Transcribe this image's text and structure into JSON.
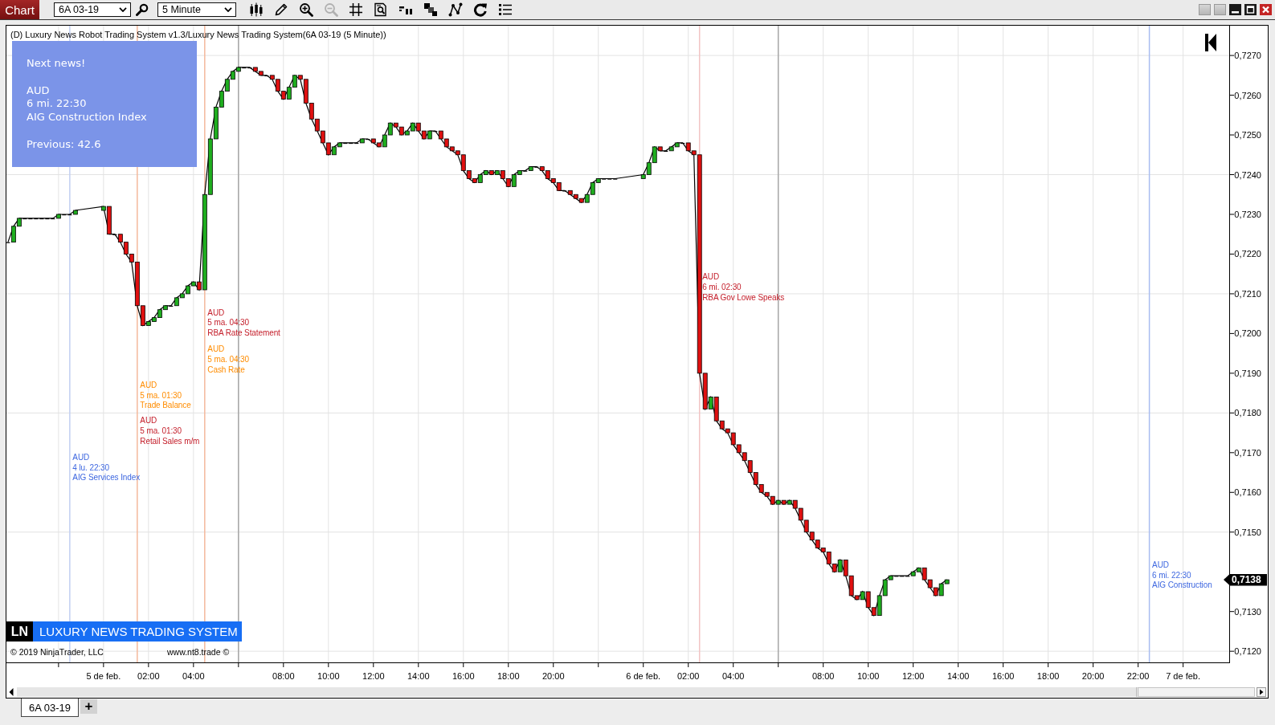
{
  "toolbar": {
    "title": "Chart",
    "instrument": "6A 03-19",
    "interval": "5 Minute",
    "zoom_out": {
      "disabled": true
    }
  },
  "chart": {
    "title": "(D) Luxury News Robot Trading System v1.3/Luxury News Trading System(6A 03-19 (5 Minute))",
    "next_news": {
      "heading": "Next news!",
      "currency": "AUD",
      "time": "6 mi. 22:30",
      "event": "AIG Construction Index",
      "previous": "Previous: 42.6"
    },
    "last_price": "0,7138",
    "news_labels": [
      {
        "color": "#3f68e0"
      },
      {
        "color": "#ff8c00"
      },
      {
        "color": "#c41e2a"
      },
      {
        "color": "#c41e2a"
      },
      {
        "color": "#ff8c00"
      },
      {
        "color": "#c41e2a"
      },
      {
        "color": "#3f68e0"
      }
    ],
    "branding": {
      "badge": "LN",
      "name": "LUXURY NEWS TRADING SYSTEM"
    },
    "copyright": "© 2019 NinjaTrader, LLC",
    "website": "www.nt8.trade ©",
    "chart_data": {
      "type": "line",
      "xlim": [
        "2019-02-04T19:41",
        "2019-02-07T02:03"
      ],
      "ylim": [
        0.71172,
        0.72775
      ],
      "xticks": [
        {
          "value": "2019-02-05T00:00",
          "label": "5 de feb."
        },
        {
          "value": "2019-02-05T02:00",
          "label": "02:00"
        },
        {
          "value": "2019-02-05T04:00",
          "label": "04:00"
        },
        {
          "value": "2019-02-05T08:00",
          "label": "08:00"
        },
        {
          "value": "2019-02-05T10:00",
          "label": "10:00"
        },
        {
          "value": "2019-02-05T12:00",
          "label": "12:00"
        },
        {
          "value": "2019-02-05T14:00",
          "label": "14:00"
        },
        {
          "value": "2019-02-05T16:00",
          "label": "16:00"
        },
        {
          "value": "2019-02-05T18:00",
          "label": "18:00"
        },
        {
          "value": "2019-02-05T20:00",
          "label": "20:00"
        },
        {
          "value": "2019-02-06T00:00",
          "label": "6 de feb."
        },
        {
          "value": "2019-02-06T02:00",
          "label": "02:00"
        },
        {
          "value": "2019-02-06T04:00",
          "label": "04:00"
        },
        {
          "value": "2019-02-06T08:00",
          "label": "08:00"
        },
        {
          "value": "2019-02-06T10:00",
          "label": "10:00"
        },
        {
          "value": "2019-02-06T12:00",
          "label": "12:00"
        },
        {
          "value": "2019-02-06T14:00",
          "label": "14:00"
        },
        {
          "value": "2019-02-06T16:00",
          "label": "16:00"
        },
        {
          "value": "2019-02-06T18:00",
          "label": "18:00"
        },
        {
          "value": "2019-02-06T20:00",
          "label": "20:00"
        },
        {
          "value": "2019-02-06T22:00",
          "label": "22:00"
        },
        {
          "value": "2019-02-07T00:00",
          "label": "7 de feb."
        }
      ],
      "yticks": [
        {
          "value": 0.727,
          "label": "0,7270"
        },
        {
          "value": 0.726,
          "label": "0,7260"
        },
        {
          "value": 0.725,
          "label": "0,7250"
        },
        {
          "value": 0.724,
          "label": "0,7240"
        },
        {
          "value": 0.723,
          "label": "0,7230"
        },
        {
          "value": 0.722,
          "label": "0,7220"
        },
        {
          "value": 0.721,
          "label": "0,7210"
        },
        {
          "value": 0.72,
          "label": "0,7200"
        },
        {
          "value": 0.719,
          "label": "0,7190"
        },
        {
          "value": 0.718,
          "label": "0,7180"
        },
        {
          "value": 0.717,
          "label": "0,7170"
        },
        {
          "value": 0.716,
          "label": "0,7160"
        },
        {
          "value": 0.715,
          "label": "0,7150"
        },
        {
          "value": 0.713,
          "label": "0,7130"
        },
        {
          "value": 0.712,
          "label": "0,7120"
        }
      ],
      "x": [
        "2019-02-04T19:45",
        "2019-02-04T20:00",
        "2019-02-04T20:15",
        "2019-02-04T20:30",
        "2019-02-04T20:45",
        "2019-02-04T21:00",
        "2019-02-04T21:15",
        "2019-02-04T21:30",
        "2019-02-04T21:45",
        "2019-02-04T22:00",
        "2019-02-04T22:15",
        "2019-02-04T22:30",
        "2019-02-04T22:45",
        "2019-02-05T00:00",
        "2019-02-05T00:15",
        "2019-02-05T00:30",
        "2019-02-05T00:45",
        "2019-02-05T01:00",
        "2019-02-05T01:15",
        "2019-02-05T01:30",
        "2019-02-05T01:45",
        "2019-02-05T02:00",
        "2019-02-05T02:15",
        "2019-02-05T02:30",
        "2019-02-05T02:45",
        "2019-02-05T03:00",
        "2019-02-05T03:15",
        "2019-02-05T03:30",
        "2019-02-05T03:45",
        "2019-02-05T04:00",
        "2019-02-05T04:15",
        "2019-02-05T04:30",
        "2019-02-05T04:45",
        "2019-02-05T05:00",
        "2019-02-05T05:15",
        "2019-02-05T05:30",
        "2019-02-05T05:45",
        "2019-02-05T06:00",
        "2019-02-05T06:15",
        "2019-02-05T06:30",
        "2019-02-05T06:45",
        "2019-02-05T07:00",
        "2019-02-05T07:15",
        "2019-02-05T07:30",
        "2019-02-05T07:45",
        "2019-02-05T08:00",
        "2019-02-05T08:15",
        "2019-02-05T08:30",
        "2019-02-05T08:45",
        "2019-02-05T09:00",
        "2019-02-05T09:15",
        "2019-02-05T09:30",
        "2019-02-05T09:45",
        "2019-02-05T10:00",
        "2019-02-05T10:15",
        "2019-02-05T10:30",
        "2019-02-05T10:45",
        "2019-02-05T11:00",
        "2019-02-05T11:15",
        "2019-02-05T11:30",
        "2019-02-05T11:45",
        "2019-02-05T12:00",
        "2019-02-05T12:15",
        "2019-02-05T12:30",
        "2019-02-05T12:45",
        "2019-02-05T13:00",
        "2019-02-05T13:15",
        "2019-02-05T13:30",
        "2019-02-05T13:45",
        "2019-02-05T14:00",
        "2019-02-05T14:15",
        "2019-02-05T14:30",
        "2019-02-05T14:45",
        "2019-02-05T15:00",
        "2019-02-05T15:15",
        "2019-02-05T15:30",
        "2019-02-05T15:45",
        "2019-02-05T16:00",
        "2019-02-05T16:15",
        "2019-02-05T16:30",
        "2019-02-05T16:45",
        "2019-02-05T17:00",
        "2019-02-05T17:15",
        "2019-02-05T17:30",
        "2019-02-05T17:45",
        "2019-02-05T18:00",
        "2019-02-05T18:15",
        "2019-02-05T18:30",
        "2019-02-05T18:45",
        "2019-02-05T19:00",
        "2019-02-05T19:15",
        "2019-02-05T19:30",
        "2019-02-05T19:45",
        "2019-02-05T20:00",
        "2019-02-05T20:15",
        "2019-02-05T20:30",
        "2019-02-05T20:45",
        "2019-02-05T21:00",
        "2019-02-05T21:15",
        "2019-02-05T21:30",
        "2019-02-05T21:45",
        "2019-02-05T22:00",
        "2019-02-05T22:15",
        "2019-02-05T22:30",
        "2019-02-05T22:45",
        "2019-02-06T00:00",
        "2019-02-06T00:15",
        "2019-02-06T00:30",
        "2019-02-06T00:45",
        "2019-02-06T01:00",
        "2019-02-06T01:15",
        "2019-02-06T01:30",
        "2019-02-06T01:45",
        "2019-02-06T02:00",
        "2019-02-06T02:15",
        "2019-02-06T02:30",
        "2019-02-06T02:45",
        "2019-02-06T03:00",
        "2019-02-06T03:15",
        "2019-02-06T03:30",
        "2019-02-06T03:45",
        "2019-02-06T04:00",
        "2019-02-06T04:15",
        "2019-02-06T04:30",
        "2019-02-06T04:45",
        "2019-02-06T05:00",
        "2019-02-06T05:15",
        "2019-02-06T05:30",
        "2019-02-06T05:45",
        "2019-02-06T06:00",
        "2019-02-06T06:15",
        "2019-02-06T06:30",
        "2019-02-06T06:45",
        "2019-02-06T07:00",
        "2019-02-06T07:15",
        "2019-02-06T07:30",
        "2019-02-06T07:45",
        "2019-02-06T08:00",
        "2019-02-06T08:15",
        "2019-02-06T08:30",
        "2019-02-06T08:45",
        "2019-02-06T09:00",
        "2019-02-06T09:15",
        "2019-02-06T09:30",
        "2019-02-06T09:45",
        "2019-02-06T10:00",
        "2019-02-06T10:15",
        "2019-02-06T10:30",
        "2019-02-06T10:45",
        "2019-02-06T11:00",
        "2019-02-06T11:15",
        "2019-02-06T11:30",
        "2019-02-06T11:45",
        "2019-02-06T12:00",
        "2019-02-06T12:15",
        "2019-02-06T12:30",
        "2019-02-06T12:45",
        "2019-02-06T13:00",
        "2019-02-06T13:15",
        "2019-02-06T13:30"
      ],
      "values": [
        0.7223,
        0.7227,
        0.7229,
        0.7229,
        0.7229,
        0.7229,
        0.7229,
        0.7229,
        0.7229,
        0.723,
        0.723,
        0.723,
        0.7231,
        0.7232,
        0.7225,
        0.7225,
        0.7223,
        0.722,
        0.7218,
        0.7207,
        0.7202,
        0.7203,
        0.7204,
        0.7206,
        0.7207,
        0.7207,
        0.7209,
        0.721,
        0.7212,
        0.7213,
        0.7211,
        0.7235,
        0.7249,
        0.7257,
        0.7261,
        0.7264,
        0.7266,
        0.7267,
        0.7267,
        0.7267,
        0.7266,
        0.7265,
        0.7265,
        0.7264,
        0.7261,
        0.7259,
        0.7262,
        0.7265,
        0.7264,
        0.7258,
        0.7254,
        0.7251,
        0.7248,
        0.7245,
        0.7247,
        0.7248,
        0.7248,
        0.7248,
        0.7248,
        0.7249,
        0.7249,
        0.7248,
        0.7247,
        0.725,
        0.7253,
        0.7252,
        0.725,
        0.7251,
        0.7253,
        0.7251,
        0.7249,
        0.7251,
        0.7251,
        0.7249,
        0.7247,
        0.7246,
        0.7245,
        0.7241,
        0.7239,
        0.7238,
        0.724,
        0.7241,
        0.724,
        0.7241,
        0.7239,
        0.7237,
        0.724,
        0.7241,
        0.7241,
        0.7242,
        0.7242,
        0.7241,
        0.7239,
        0.7238,
        0.7236,
        0.7236,
        0.7235,
        0.7234,
        0.7233,
        0.7235,
        0.7238,
        0.7239,
        0.7239,
        0.7239,
        0.7239,
        0.724,
        0.7243,
        0.7247,
        0.7246,
        0.7246,
        0.7247,
        0.7248,
        0.7248,
        0.7246,
        0.7245,
        0.719,
        0.7181,
        0.7184,
        0.7178,
        0.7176,
        0.7175,
        0.7172,
        0.717,
        0.7168,
        0.7165,
        0.7162,
        0.716,
        0.7159,
        0.7157,
        0.7158,
        0.7157,
        0.7158,
        0.7156,
        0.7153,
        0.715,
        0.7148,
        0.7146,
        0.7145,
        0.7142,
        0.714,
        0.7143,
        0.7139,
        0.7134,
        0.7133,
        0.7135,
        0.7131,
        0.7129,
        0.7134,
        0.7138,
        0.7139,
        0.7139,
        0.7139,
        0.7139,
        0.714,
        0.7141,
        0.7138,
        0.7136,
        0.7134,
        0.7137,
        0.7138
      ],
      "ref_lines": [
        {
          "axis": "x",
          "value": "2019-02-04T22:30",
          "color": "#c2d0f2"
        },
        {
          "axis": "x",
          "value": "2019-02-05T01:30",
          "color": "#f4b99c"
        },
        {
          "axis": "x",
          "value": "2019-02-05T04:30",
          "color": "#f4b99c"
        },
        {
          "axis": "x",
          "value": "2019-02-05T06:00",
          "color": "#a6a6a6"
        },
        {
          "axis": "x",
          "value": "2019-02-06T02:30",
          "color": "#f2c4c4"
        },
        {
          "axis": "x",
          "value": "2019-02-06T06:00",
          "color": "#a6a6a6"
        },
        {
          "axis": "x",
          "value": "2019-02-06T22:30",
          "color": "#a9bdf0"
        }
      ],
      "annotations": [
        {
          "text": "AUD\n4 lu. 22:30\nAIG Services Index",
          "x": "2019-02-04T22:30",
          "y": 0.717
        },
        {
          "text": "AUD\n5 ma. 01:30\nTrade Balance",
          "x": "2019-02-05T01:30",
          "y": 0.71882
        },
        {
          "text": "AUD\n5 ma. 01:30\nRetail Sales m/m",
          "x": "2019-02-05T01:30",
          "y": 0.71792
        },
        {
          "text": "AUD\n5 ma. 04:30\nRBA Rate Statement",
          "x": "2019-02-05T04:30",
          "y": 0.72064
        },
        {
          "text": "AUD\n5 ma. 04:30\nCash Rate",
          "x": "2019-02-05T04:30",
          "y": 0.71972
        },
        {
          "text": "AUD\n6 mi. 02:30\nRBA Gov Lowe Speaks",
          "x": "2019-02-06T02:30",
          "y": 0.72154
        },
        {
          "text": "AUD\n6 mi. 22:30\nAIG Construction",
          "x": "2019-02-06T22:30",
          "y": 0.71429
        }
      ]
    }
  },
  "tabs": [
    {
      "label": "6A 03-19",
      "selected": true
    }
  ],
  "new_tab": "+"
}
